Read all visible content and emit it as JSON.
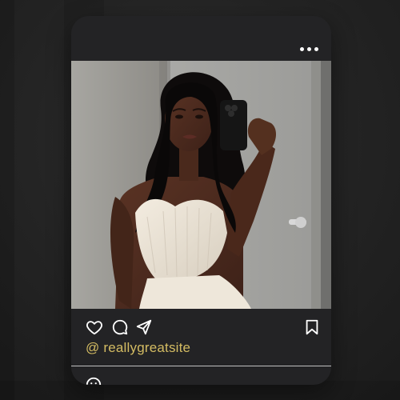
{
  "post": {
    "handle": "@ reallygreatsite"
  },
  "icons": {
    "more": "more-options-icon",
    "like": "heart-icon",
    "comment": "comment-icon",
    "share": "send-icon",
    "save": "bookmark-icon",
    "emoji": "emoji-icon"
  },
  "colors": {
    "background": "#252525",
    "card": "#232325",
    "handle": "#d4bc63",
    "icon": "#ffffff",
    "divider": "#bfbfbf"
  }
}
